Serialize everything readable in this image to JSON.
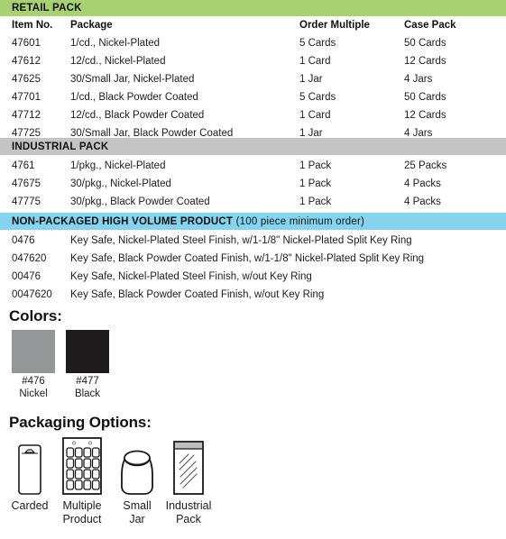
{
  "colors": {
    "retail_bar": "#a8d171",
    "industrial_bar": "#c4c4c4",
    "nonpackaged_bar": "#84d4ef",
    "nickel_swatch": "#949698",
    "black_swatch": "#1e1c1c"
  },
  "retail": {
    "bar_title": "RETAIL PACK",
    "headers": {
      "item": "Item No.",
      "package": "Package",
      "order": "Order Multiple",
      "case": "Case Pack"
    },
    "rows": [
      {
        "item": "47601",
        "package": "1/cd., Nickel-Plated",
        "order": "5 Cards",
        "case": "50 Cards"
      },
      {
        "item": "47612",
        "package": "12/cd., Nickel-Plated",
        "order": "1 Card",
        "case": "12 Cards"
      },
      {
        "item": "47625",
        "package": "30/Small Jar, Nickel-Plated",
        "order": "1 Jar",
        "case": "4 Jars"
      },
      {
        "item": "47701",
        "package": "1/cd., Black Powder Coated",
        "order": "5 Cards",
        "case": "50 Cards"
      },
      {
        "item": "47712",
        "package": "12/cd., Black Powder Coated",
        "order": "1 Card",
        "case": "12 Cards"
      },
      {
        "item": "47725",
        "package": "30/Small Jar, Black Powder Coated",
        "order": "1 Jar",
        "case": "4 Jars"
      }
    ]
  },
  "industrial": {
    "bar_title": "INDUSTRIAL  PACK",
    "rows": [
      {
        "item": "4761",
        "package": "1/pkg., Nickel-Plated",
        "order": "1 Pack",
        "case": "25 Packs"
      },
      {
        "item": "47675",
        "package": "30/pkg., Nickel-Plated",
        "order": "1 Pack",
        "case": "4 Packs"
      },
      {
        "item": "47775",
        "package": "30/pkg., Black Powder Coated",
        "order": "1 Pack",
        "case": "4 Packs"
      }
    ]
  },
  "nonpackaged": {
    "bar_title": "NON-PACKAGED HIGH VOLUME PRODUCT",
    "bar_note": "(100 piece minimum order)",
    "rows": [
      {
        "item": "0476",
        "description": "Key Safe, Nickel-Plated Steel Finish, w/1-1/8\" Nickel-Plated Split Key Ring"
      },
      {
        "item": "047620",
        "description": "Key Safe, Black Powder Coated Finish, w/1-1/8\" Nickel-Plated Split Key Ring"
      },
      {
        "item": "00476",
        "description": "Key Safe, Nickel-Plated Steel Finish, w/out Key Ring"
      },
      {
        "item": "0047620",
        "description": "Key Safe, Black Powder Coated Finish, w/out Key Ring"
      }
    ]
  },
  "colors_section": {
    "title": "Colors:",
    "swatches": [
      {
        "code": "#476",
        "name": "Nickel"
      },
      {
        "code": "#477",
        "name": "Black"
      }
    ]
  },
  "packaging_section": {
    "title": "Packaging Options:",
    "options": [
      {
        "line1": "Carded",
        "line2": ""
      },
      {
        "line1": "Multiple",
        "line2": "Product"
      },
      {
        "line1": "Small",
        "line2": "Jar"
      },
      {
        "line1": "Industrial",
        "line2": "Pack"
      }
    ]
  }
}
